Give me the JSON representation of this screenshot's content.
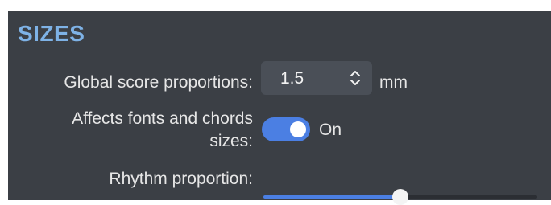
{
  "section": {
    "title": "SIZES"
  },
  "global_score": {
    "label": "Global score proportions:",
    "value": "1.5",
    "unit": "mm",
    "arrows_icon": "up-down-chevron-icon"
  },
  "affects_fonts": {
    "label_line1": "Affects fonts and chords",
    "label_line2": "sizes:",
    "toggle_on": true,
    "state_text": "On"
  },
  "rhythm": {
    "label": "Rhythm proportion:",
    "value_fraction": 0.5
  },
  "colors": {
    "panel_bg": "#3b3f45",
    "accent": "#4b7fe3",
    "title": "#7eb2e6",
    "text": "#e6e6e6"
  }
}
